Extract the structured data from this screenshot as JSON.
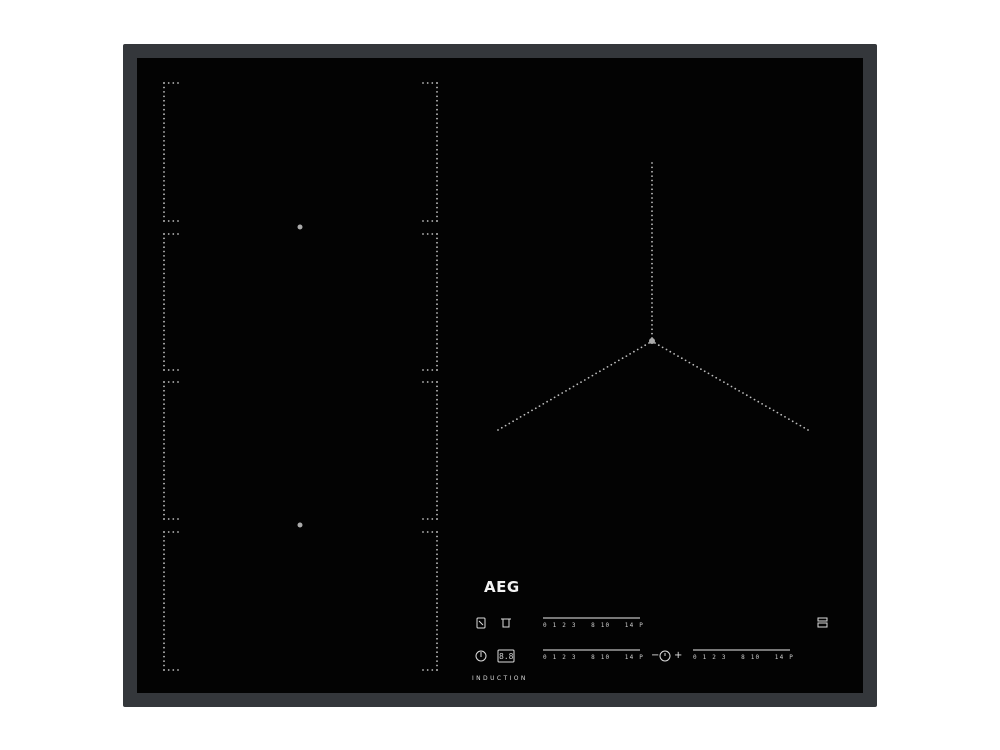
{
  "brand": {
    "logo": "AEG",
    "subtitle": "INDUCTION"
  },
  "controls": {
    "slider_scale": "0 1 2 3   8 10   14 P",
    "timer_minus": "−",
    "timer_plus": "+",
    "icons": {
      "bridge": "bridge-icon",
      "pot": "pot-icon",
      "power": "power-icon",
      "lock": "lock-icon",
      "timer": "timer-icon",
      "hob2hood": "hob2hood-icon"
    },
    "display_value": "8.8"
  },
  "colors": {
    "glass": "#030303",
    "frame": "#34373b",
    "marking": "#cfcfcf"
  }
}
